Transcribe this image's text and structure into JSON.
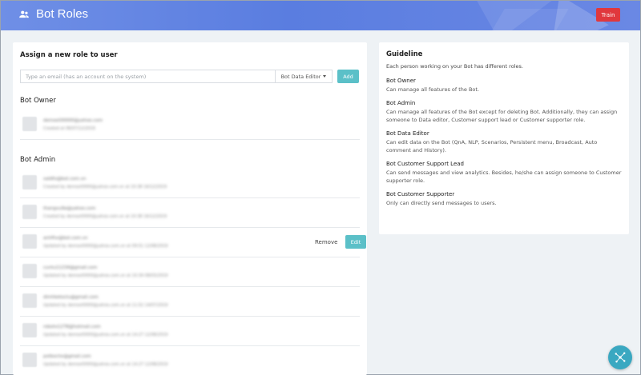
{
  "header": {
    "title": "Bot Roles",
    "train_label": "Train"
  },
  "assign": {
    "title": "Assign a new role to user",
    "email_placeholder": "Type an email (has an account on the system)",
    "role_selected": "Bot Data Editor",
    "add_label": "Add"
  },
  "owner": {
    "title": "Bot Owner",
    "members": [
      {
        "email": "demoxt00000@yahoo.com",
        "meta": "Created at 06/07/12/2019"
      }
    ]
  },
  "admin": {
    "title": "Bot Admin",
    "remove_label": "Remove",
    "edit_label": "Edit",
    "members": [
      {
        "email": "xaldfx@bot.com.vn",
        "meta": "Created by demoxt0000@yahoo.com.vn at 10:38 16/12/2019"
      },
      {
        "email": "thangvu9a@yahoo.com",
        "meta": "Created by demoxt0000@yahoo.com.vn at 10:38 16/12/2019"
      },
      {
        "email": "anhfhx@bot.com.vn",
        "meta": "Updated by demoxt0000@yahoo.com.vn at 09:51 12/08/2019"
      },
      {
        "email": "cuntu11234@gmail.com",
        "meta": "Updated by demoxt0000@yahoo.com.vn at 10:34 08/03/2019"
      },
      {
        "email": "dimhketoctu@gmail.com",
        "meta": "Updated by demoxt0000@yahoo.com.vn at 11:52 14/07/2019"
      },
      {
        "email": "robotx1278@hotmail.com",
        "meta": "Updated by demoxt0000@yahoo.com.vn at 14:27 12/08/2019"
      },
      {
        "email": "pxtbxchx@gmail.com",
        "meta": "Updated by demoxt0000@yahoo.com.vn at 14:27 12/08/2019"
      }
    ]
  },
  "guideline": {
    "title": "Guideline",
    "intro": "Each person working on your Bot has different roles.",
    "roles": [
      {
        "name": "Bot Owner",
        "desc": "Can manage all features of the Bot."
      },
      {
        "name": "Bot Admin",
        "desc": "Can manage all features of the Bot except for deleting Bot. Additionally, they can assign someone to Data editor, Customer support lead or Customer supporter role."
      },
      {
        "name": "Bot Data Editor",
        "desc": "Can edit data on the Bot (QnA, NLP, Scenarios, Persistent menu, Broadcast, Auto comment and History)."
      },
      {
        "name": "Bot Customer Support Lead",
        "desc": "Can send messages and view analytics. Besides, he/she can assign someone to Customer supporter role."
      },
      {
        "name": "Bot Customer Supporter",
        "desc": "Only can directly send messages to users."
      }
    ]
  },
  "colors": {
    "header": "#5a7de0",
    "train": "#e0383d",
    "accent": "#5bc0c8",
    "fab": "#3aa8c1"
  },
  "icons": {
    "title": "users-icon",
    "fab": "robot-chat-icon"
  }
}
